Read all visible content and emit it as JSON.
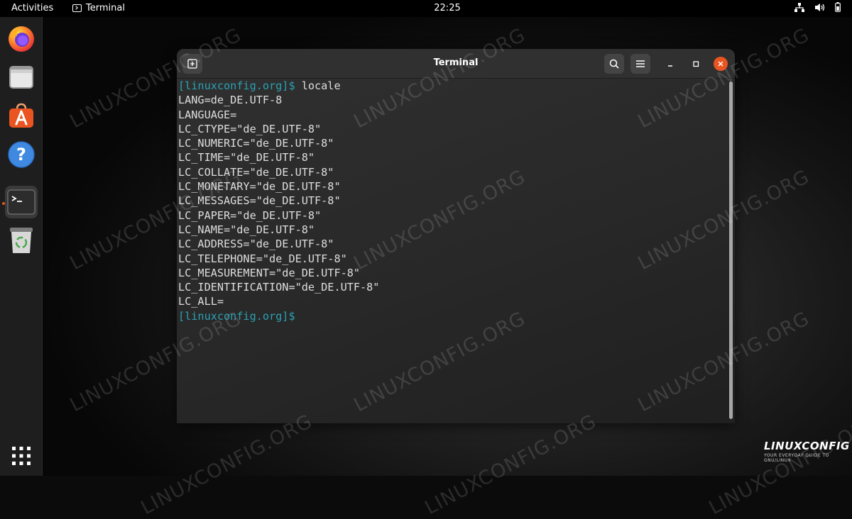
{
  "topbar": {
    "activities_label": "Activities",
    "app_name": "Terminal",
    "clock": "22:25"
  },
  "dock": {
    "items": [
      {
        "name": "firefox-icon"
      },
      {
        "name": "files-icon"
      },
      {
        "name": "software-icon"
      },
      {
        "name": "help-icon"
      },
      {
        "name": "terminal-icon",
        "active": true
      },
      {
        "name": "trash-icon"
      },
      {
        "name": "show-apps-icon"
      }
    ]
  },
  "watermark": "LINUXCONFIG.ORG",
  "terminal": {
    "title": "Terminal",
    "lines": [
      {
        "prompt": "[linuxconfig.org]$",
        "text": " locale"
      },
      {
        "prompt": "",
        "text": "LANG=de_DE.UTF-8"
      },
      {
        "prompt": "",
        "text": "LANGUAGE="
      },
      {
        "prompt": "",
        "text": "LC_CTYPE=\"de_DE.UTF-8\""
      },
      {
        "prompt": "",
        "text": "LC_NUMERIC=\"de_DE.UTF-8\""
      },
      {
        "prompt": "",
        "text": "LC_TIME=\"de_DE.UTF-8\""
      },
      {
        "prompt": "",
        "text": "LC_COLLATE=\"de_DE.UTF-8\""
      },
      {
        "prompt": "",
        "text": "LC_MONETARY=\"de_DE.UTF-8\""
      },
      {
        "prompt": "",
        "text": "LC_MESSAGES=\"de_DE.UTF-8\""
      },
      {
        "prompt": "",
        "text": "LC_PAPER=\"de_DE.UTF-8\""
      },
      {
        "prompt": "",
        "text": "LC_NAME=\"de_DE.UTF-8\""
      },
      {
        "prompt": "",
        "text": "LC_ADDRESS=\"de_DE.UTF-8\""
      },
      {
        "prompt": "",
        "text": "LC_TELEPHONE=\"de_DE.UTF-8\""
      },
      {
        "prompt": "",
        "text": "LC_MEASUREMENT=\"de_DE.UTF-8\""
      },
      {
        "prompt": "",
        "text": "LC_IDENTIFICATION=\"de_DE.UTF-8\""
      },
      {
        "prompt": "",
        "text": "LC_ALL="
      },
      {
        "prompt": "[linuxconfig.org]$",
        "text": ""
      }
    ]
  },
  "logo": {
    "main": "LINUXCONFIG",
    "sub": "YOUR EVERYDAY GUIDE TO GNU/LINUX"
  },
  "colors": {
    "prompt": "#2aa1b3",
    "close_button": "#e95420",
    "accent": "#e95420"
  }
}
